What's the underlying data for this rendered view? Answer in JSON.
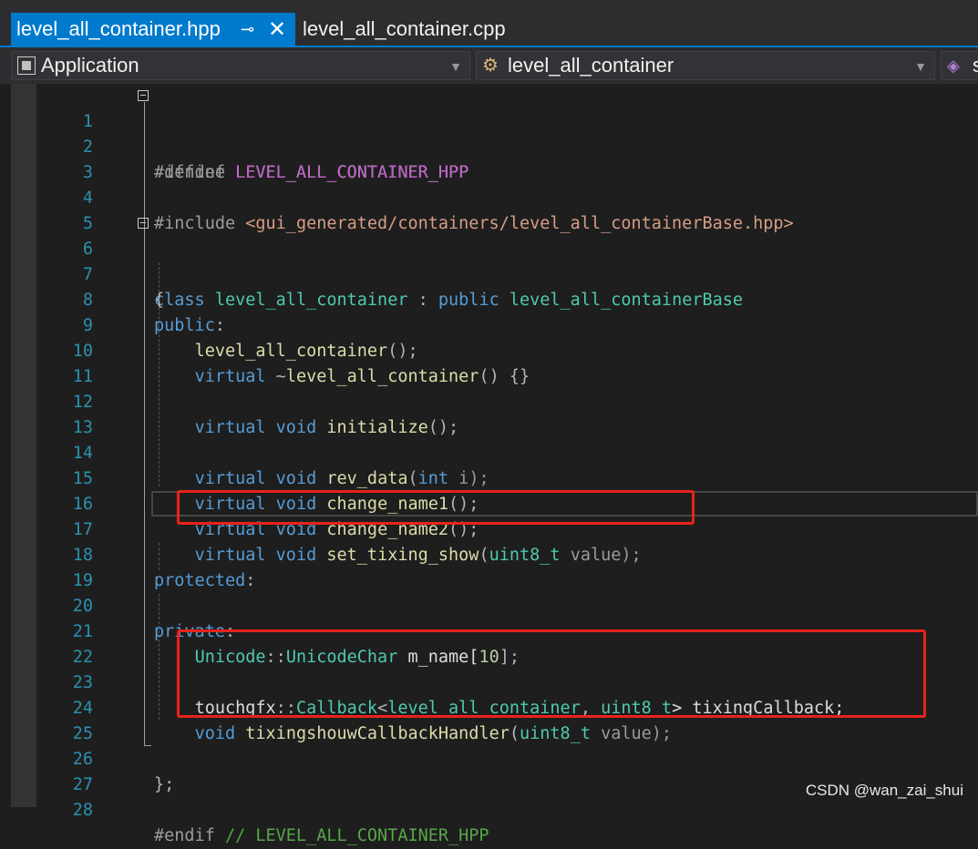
{
  "tabs": [
    {
      "label": "level_all_container.hpp",
      "active": true
    },
    {
      "label": "level_all_container.cpp",
      "active": false
    }
  ],
  "tab_icons": {
    "pin": "pin-icon",
    "close": "close-icon"
  },
  "navbar": {
    "project": "Application",
    "scope": "level_all_container",
    "member_partial": "s"
  },
  "editor": {
    "lines": [
      {
        "n": "1"
      },
      {
        "n": "2"
      },
      {
        "n": "3"
      },
      {
        "n": "4"
      },
      {
        "n": "5"
      },
      {
        "n": "6"
      },
      {
        "n": "7"
      },
      {
        "n": "8"
      },
      {
        "n": "9"
      },
      {
        "n": "10"
      },
      {
        "n": "11"
      },
      {
        "n": "12"
      },
      {
        "n": "13"
      },
      {
        "n": "14"
      },
      {
        "n": "15"
      },
      {
        "n": "16"
      },
      {
        "n": "17"
      },
      {
        "n": "18"
      },
      {
        "n": "19"
      },
      {
        "n": "20"
      },
      {
        "n": "21"
      },
      {
        "n": "22"
      },
      {
        "n": "23"
      },
      {
        "n": "24"
      },
      {
        "n": "25"
      },
      {
        "n": "26"
      },
      {
        "n": "27"
      },
      {
        "n": "28"
      }
    ],
    "tokens": {
      "l1": [
        "#ifndef ",
        "LEVEL_ALL_CONTAINER_HPP"
      ],
      "l2": [
        "#define ",
        "LEVEL_ALL_CONTAINER_HPP"
      ],
      "l4": [
        "#include ",
        "<gui_generated/containers/level_all_containerBase.hpp>"
      ],
      "l6": [
        "class",
        " ",
        "level_all_container",
        " : ",
        "public",
        " ",
        "level_all_containerBase"
      ],
      "l7": [
        "{"
      ],
      "l8": [
        "public",
        ":"
      ],
      "l9": [
        "    ",
        "level_all_container",
        "();"
      ],
      "l10": [
        "    ",
        "virtual",
        " ~",
        "level_all_container",
        "() {}"
      ],
      "l12": [
        "    ",
        "virtual",
        " ",
        "void",
        " ",
        "initialize",
        "();"
      ],
      "l14": [
        "    ",
        "virtual",
        " ",
        "void",
        " ",
        "rev_data",
        "(",
        "int",
        " i);"
      ],
      "l15": [
        "    ",
        "virtual",
        " ",
        "void",
        " ",
        "change_name1",
        "();"
      ],
      "l16": [
        "    ",
        "virtual",
        " ",
        "void",
        " ",
        "change_name2",
        "();"
      ],
      "l17": [
        "    ",
        "virtual",
        " ",
        "void",
        " ",
        "set_tixing_show",
        "(",
        "uint8_t",
        " value);"
      ],
      "l18": [
        "protected",
        ":"
      ],
      "l20": [
        "private",
        ":"
      ],
      "l21": [
        "    ",
        "Unicode",
        "::",
        "UnicodeChar",
        " m_name[",
        "10",
        "];"
      ],
      "l23": [
        "    ",
        "touchgfx",
        "::",
        "Callback",
        "<",
        "level_all_container",
        ", ",
        "uint8_t",
        "> tixingCallback;"
      ],
      "l24": [
        "    ",
        "void",
        " ",
        "tixingshouwCallbackHandler",
        "(",
        "uint8_t",
        " value);"
      ],
      "l26": [
        "};"
      ],
      "l28": [
        "#endif ",
        "// LEVEL_ALL_CONTAINER_HPP"
      ]
    }
  },
  "watermark": "CSDN @wan_zai_shui",
  "colors": {
    "accent": "#007acc",
    "highlight_box": "#e8231a",
    "line_numbers": "#2b91af",
    "keyword": "#569cd6",
    "type": "#4ec9b0",
    "macro": "#bd63c5",
    "string": "#d69d85",
    "comment": "#57a64a"
  }
}
